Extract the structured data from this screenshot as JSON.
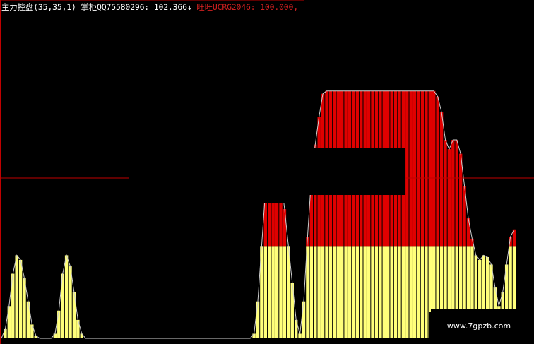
{
  "header": {
    "indicator": "主力控盘",
    "params": "(35,35,1)",
    "s1_label": "掌柜QQ75580296:",
    "s1_value": "102.366",
    "s1_arrow": "↓",
    "s2_label": "旺旺UCRG2046:",
    "s2_value": "100.000,",
    "color_white": "#ffffff",
    "color_s1": "#ffffff",
    "color_s2": "#cc2222"
  },
  "watermark": {
    "text": "www.7gpzb.com"
  },
  "chart_data": {
    "type": "area",
    "series": [
      {
        "legend_label": "掌柜QQ75580296",
        "color": "#ffff7a",
        "above_color": "#e00000",
        "stroke": "#bbbbbb",
        "baseline": 100,
        "values": [
          0,
          10,
          35,
          70,
          90,
          85,
          65,
          40,
          15,
          3,
          0,
          0,
          0,
          0,
          5,
          30,
          70,
          90,
          78,
          50,
          20,
          5,
          0,
          0,
          0,
          0,
          0,
          0,
          0,
          0,
          0,
          0,
          0,
          0,
          0,
          0,
          0,
          0,
          0,
          0,
          0,
          0,
          0,
          0,
          0,
          0,
          0,
          0,
          0,
          0,
          0,
          0,
          0,
          0,
          0,
          0,
          0,
          0,
          0,
          0,
          0,
          0,
          0,
          0,
          0,
          0,
          5,
          40,
          100,
          160,
          195,
          195,
          195,
          175,
          140,
          100,
          60,
          20,
          5,
          40,
          110,
          175,
          210,
          240,
          265,
          268,
          268,
          268,
          268,
          268,
          268,
          268,
          268,
          268,
          268,
          268,
          268,
          268,
          268,
          268,
          268,
          268,
          268,
          268,
          268,
          268,
          268,
          268,
          268,
          268,
          268,
          268,
          268,
          268,
          262,
          245,
          215,
          205,
          215,
          215,
          200,
          165,
          130,
          108,
          90,
          85,
          90,
          88,
          80,
          55,
          35,
          50,
          80,
          110,
          118
        ]
      }
    ],
    "ylim": [
      0,
      290
    ],
    "reference_line": 100
  }
}
